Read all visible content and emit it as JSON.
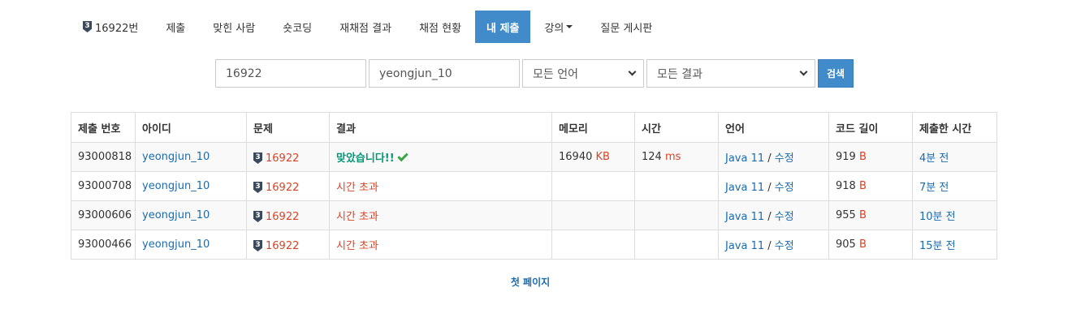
{
  "nav": {
    "problem_tier": "3",
    "problem_tab": "16922번",
    "submit": "제출",
    "solvers": "맞힌 사람",
    "short_coding": "숏코딩",
    "rejudge": "재채점 결과",
    "judge_status": "채점 현황",
    "my_submissions": "내 제출",
    "lectures": "강의",
    "board": "질문 게시판"
  },
  "search": {
    "problem_id": "16922",
    "user_id": "yeongjun_10",
    "language": "모든 언어",
    "result": "모든 결과",
    "button": "검색"
  },
  "table": {
    "headers": [
      "제출 번호",
      "아이디",
      "문제",
      "결과",
      "메모리",
      "시간",
      "언어",
      "코드 길이",
      "제출한 시간"
    ],
    "rows": [
      {
        "id": "93000818",
        "user": "yeongjun_10",
        "tier": "3",
        "problem": "16922",
        "result": "맞았습니다!!",
        "memory": "16940",
        "memory_unit": "KB",
        "time": "124",
        "time_unit": "ms",
        "lang": "Java 11",
        "sep": " / ",
        "edit": "수정",
        "length": "919",
        "length_unit": "B",
        "submitted": "4분 전"
      },
      {
        "id": "93000708",
        "user": "yeongjun_10",
        "tier": "3",
        "problem": "16922",
        "result": "시간 초과",
        "memory": "",
        "memory_unit": "",
        "time": "",
        "time_unit": "",
        "lang": "Java 11",
        "sep": " / ",
        "edit": "수정",
        "length": "918",
        "length_unit": "B",
        "submitted": "7분 전"
      },
      {
        "id": "93000606",
        "user": "yeongjun_10",
        "tier": "3",
        "problem": "16922",
        "result": "시간 초과",
        "memory": "",
        "memory_unit": "",
        "time": "",
        "time_unit": "",
        "lang": "Java 11",
        "sep": " / ",
        "edit": "수정",
        "length": "955",
        "length_unit": "B",
        "submitted": "10분 전"
      },
      {
        "id": "93000466",
        "user": "yeongjun_10",
        "tier": "3",
        "problem": "16922",
        "result": "시간 초과",
        "memory": "",
        "memory_unit": "",
        "time": "",
        "time_unit": "",
        "lang": "Java 11",
        "sep": " / ",
        "edit": "수정",
        "length": "905",
        "length_unit": "B",
        "submitted": "15분 전"
      }
    ]
  },
  "pagination": {
    "first_page": "첫 페이지"
  },
  "colors": {
    "accent": "#428bca",
    "link": "#1a6bb0",
    "error": "#dd4124",
    "accepted": "#009874",
    "check": "#3aa544"
  }
}
